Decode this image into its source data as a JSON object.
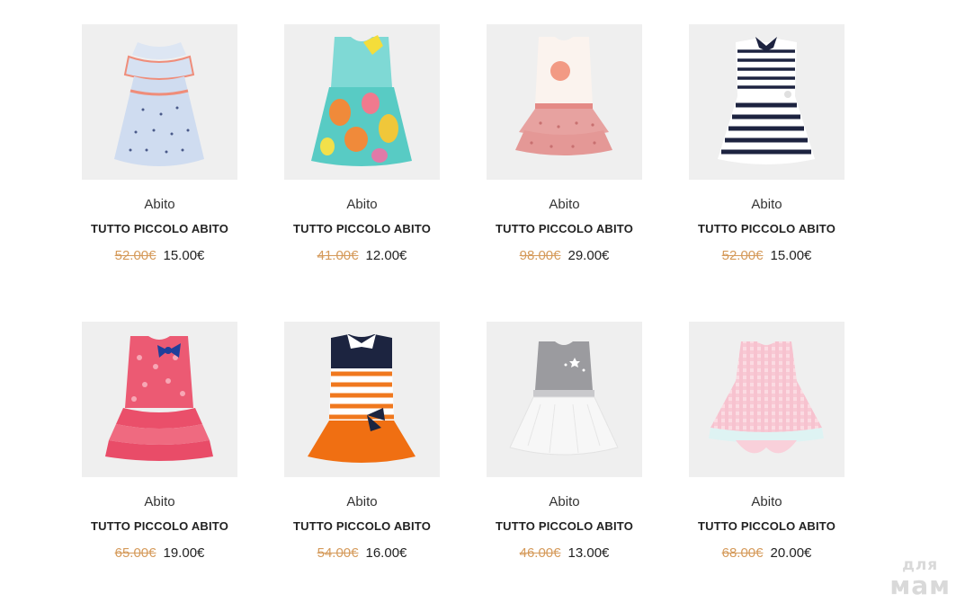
{
  "products": [
    {
      "category": "Abito",
      "title": "TUTTO PICCOLO ABITO",
      "old_price": "52.00€",
      "price": "15.00€",
      "image": "light-blue-ruffle-dress"
    },
    {
      "category": "Abito",
      "title": "TUTTO PICCOLO ABITO",
      "old_price": "41.00€",
      "price": "12.00€",
      "image": "turquoise-fruit-print-dress"
    },
    {
      "category": "Abito",
      "title": "TUTTO PICCOLO ABITO",
      "old_price": "98.00€",
      "price": "29.00€",
      "image": "white-pink-tulle-dress"
    },
    {
      "category": "Abito",
      "title": "TUTTO PICCOLO ABITO",
      "old_price": "52.00€",
      "price": "15.00€",
      "image": "navy-stripe-collar-dress"
    },
    {
      "category": "Abito",
      "title": "TUTTO PICCOLO ABITO",
      "old_price": "65.00€",
      "price": "19.00€",
      "image": "pink-ruffle-bow-dress"
    },
    {
      "category": "Abito",
      "title": "TUTTO PICCOLO ABITO",
      "old_price": "54.00€",
      "price": "16.00€",
      "image": "orange-stripe-polo-dress"
    },
    {
      "category": "Abito",
      "title": "TUTTO PICCOLO ABITO",
      "old_price": "46.00€",
      "price": "13.00€",
      "image": "grey-white-tulle-dress"
    },
    {
      "category": "Abito",
      "title": "TUTTO PICCOLO ABITO",
      "old_price": "68.00€",
      "price": "20.00€",
      "image": "pink-gingham-dress"
    }
  ],
  "watermark": {
    "line1": "для",
    "line2": "мам"
  },
  "colors": {
    "old_price": "#d59a5a",
    "thumb_bg": "#efefef"
  }
}
